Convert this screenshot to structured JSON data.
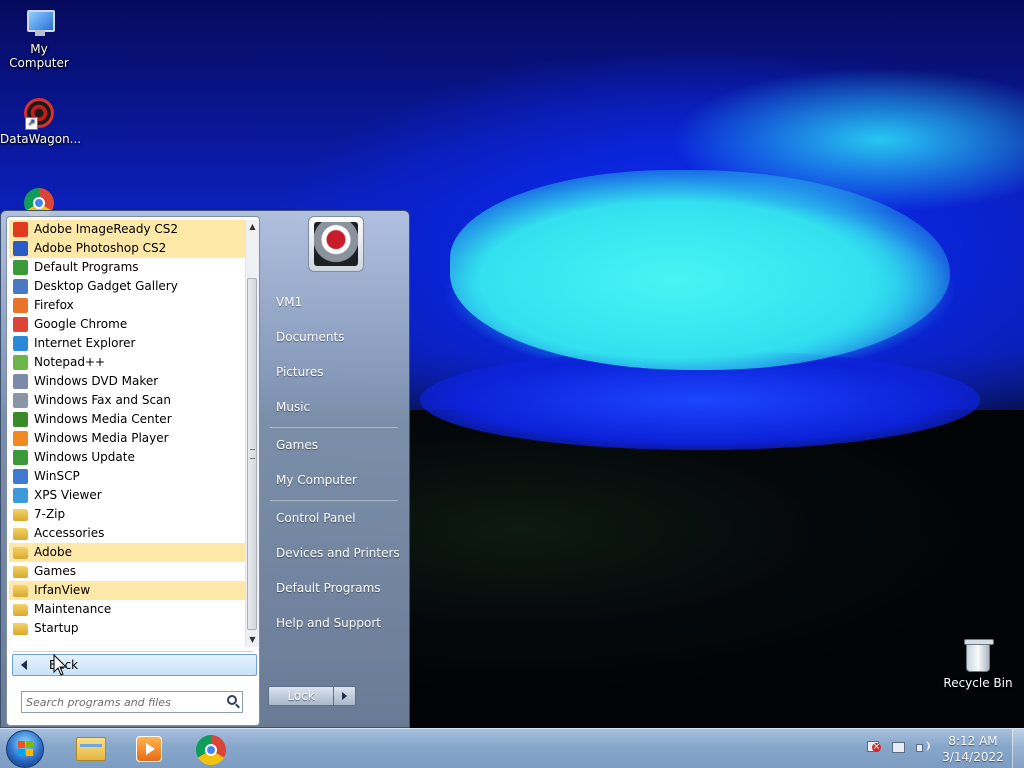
{
  "desktop": {
    "icons": [
      {
        "label": "My Computer",
        "icon": "computer-icon"
      },
      {
        "label": "DataWagon...",
        "icon": "datawagon-icon"
      },
      {
        "label": "",
        "icon": "chrome-icon"
      }
    ],
    "recycle_bin": {
      "label": "Recycle Bin",
      "icon": "recycle-bin-icon"
    }
  },
  "start_menu": {
    "programs": [
      {
        "label": "Adobe ImageReady CS2",
        "icon": "imageready-icon",
        "highlighted": true,
        "color": "#e23a1c"
      },
      {
        "label": "Adobe Photoshop CS2",
        "icon": "photoshop-icon",
        "highlighted": true,
        "color": "#2a5cc6"
      },
      {
        "label": "Default Programs",
        "icon": "default-programs-icon",
        "highlighted": false,
        "color": "#3a9a3a"
      },
      {
        "label": "Desktop Gadget Gallery",
        "icon": "gadget-gallery-icon",
        "highlighted": false,
        "color": "#4a78c4"
      },
      {
        "label": "Firefox",
        "icon": "firefox-icon",
        "highlighted": false,
        "color": "#e8742a"
      },
      {
        "label": "Google Chrome",
        "icon": "chrome-icon",
        "highlighted": false,
        "color": "#db4437"
      },
      {
        "label": "Internet Explorer",
        "icon": "internet-explorer-icon",
        "highlighted": false,
        "color": "#2a8ad8"
      },
      {
        "label": "Notepad++",
        "icon": "notepadpp-icon",
        "highlighted": false,
        "color": "#6bb64a"
      },
      {
        "label": "Windows DVD Maker",
        "icon": "dvd-maker-icon",
        "highlighted": false,
        "color": "#7a8aa8"
      },
      {
        "label": "Windows Fax and Scan",
        "icon": "fax-scan-icon",
        "highlighted": false,
        "color": "#8a96a6"
      },
      {
        "label": "Windows Media Center",
        "icon": "media-center-icon",
        "highlighted": false,
        "color": "#3a8a2a"
      },
      {
        "label": "Windows Media Player",
        "icon": "media-player-icon",
        "highlighted": false,
        "color": "#f08a20"
      },
      {
        "label": "Windows Update",
        "icon": "windows-update-icon",
        "highlighted": false,
        "color": "#3a9a3a"
      },
      {
        "label": "WinSCP",
        "icon": "winscp-icon",
        "highlighted": false,
        "color": "#3f7ad0"
      },
      {
        "label": "XPS Viewer",
        "icon": "xps-viewer-icon",
        "highlighted": false,
        "color": "#3c9ad8"
      },
      {
        "label": "7-Zip",
        "icon": "folder-icon",
        "highlighted": false,
        "color": "#e2b640"
      },
      {
        "label": "Accessories",
        "icon": "folder-icon",
        "highlighted": false,
        "color": "#e2b640"
      },
      {
        "label": "Adobe",
        "icon": "folder-icon",
        "highlighted": true,
        "color": "#e2b640"
      },
      {
        "label": "Games",
        "icon": "folder-icon",
        "highlighted": false,
        "color": "#e2b640"
      },
      {
        "label": "IrfanView",
        "icon": "folder-icon",
        "highlighted": true,
        "color": "#e2b640"
      },
      {
        "label": "Maintenance",
        "icon": "folder-icon",
        "highlighted": false,
        "color": "#e2b640"
      },
      {
        "label": "Startup",
        "icon": "folder-icon",
        "highlighted": false,
        "color": "#e2b640"
      }
    ],
    "back_label": "Back",
    "search_placeholder": "Search programs and files",
    "right_items": [
      {
        "label": "VM1"
      },
      {
        "label": "Documents"
      },
      {
        "label": "Pictures"
      },
      {
        "label": "Music"
      },
      {
        "label": "Games"
      },
      {
        "label": "My Computer"
      },
      {
        "label": "Control Panel"
      },
      {
        "label": "Devices and Printers"
      },
      {
        "label": "Default Programs"
      },
      {
        "label": "Help and Support"
      }
    ],
    "lock_label": "Lock"
  },
  "taskbar": {
    "pinned": [
      {
        "name": "windows-explorer",
        "icon": "folder-icon"
      },
      {
        "name": "windows-media-player",
        "icon": "media-player-icon"
      },
      {
        "name": "google-chrome",
        "icon": "chrome-icon"
      }
    ],
    "clock": {
      "time": "8:12 AM",
      "date": "3/14/2022"
    },
    "accent": "#86a6ca"
  }
}
